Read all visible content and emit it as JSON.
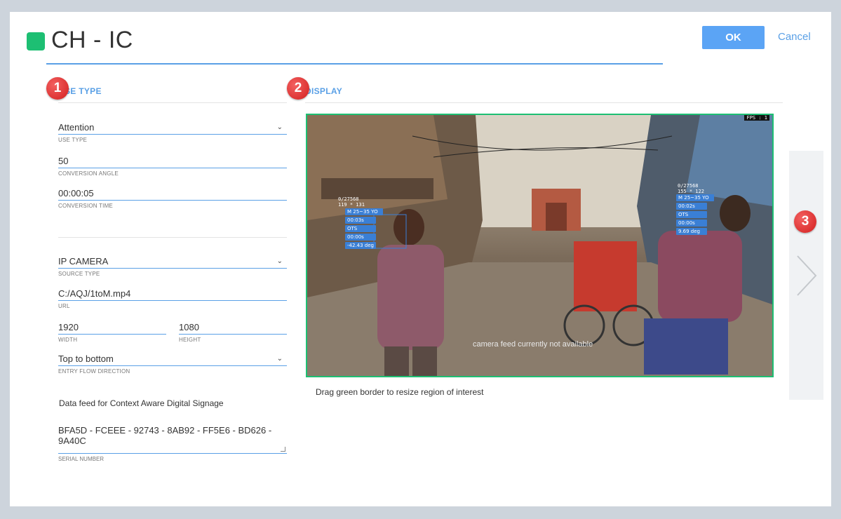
{
  "window": {
    "title": "CH - IC",
    "accent_color": "#1dbf73",
    "ok_label": "OK",
    "cancel_label": "Cancel"
  },
  "sections": {
    "use_type_heading": "USE TYPE",
    "display_heading": "DISPLAY"
  },
  "callouts": [
    "1",
    "2",
    "3"
  ],
  "use_fields": [
    {
      "value": "Attention",
      "label": "USE TYPE",
      "dropdown": true
    },
    {
      "value": "50",
      "label": "CONVERSION ANGLE"
    },
    {
      "value": "00:00:05",
      "label": "CONVERSION TIME"
    }
  ],
  "source_fields": {
    "source_type": {
      "value": "IP CAMERA",
      "label": "SOURCE TYPE"
    },
    "url": {
      "value": "C:/AQJ/1toM.mp4",
      "label": "URL"
    },
    "width": {
      "value": "1920",
      "label": "WIDTH"
    },
    "height": {
      "value": "1080",
      "label": "HEIGHT"
    },
    "entry_flow": {
      "value": "Top to bottom",
      "label": "ENTRY FLOW DIRECTION"
    }
  },
  "data_feed": {
    "heading": "Data feed for Context Aware Digital Signage",
    "serial": "BFA5D - FCEEE - 92743 - 8AB92 - FF5E6 - BD626 - 9A40C",
    "serial_label": "SERIAL NUMBER"
  },
  "display": {
    "feed_status": "camera feed currently not available",
    "hint": "Drag green border to resize region of interest",
    "fps_text": "FPS : 1",
    "left_overlay": {
      "id": "0/27568",
      "size": "119 * 131",
      "gender_age": "M 25~35 YO",
      "time": "00:03s",
      "ots": "OTS",
      "dwell": "00:00s",
      "angle": "-42.43 deg"
    },
    "right_overlay": {
      "id": "0/27568",
      "size": "155 * 122",
      "gender_age": "M 25~35 YO",
      "time": "00:02s",
      "ots": "OTS",
      "dwell": "00:00s",
      "angle": "9.69 deg"
    }
  }
}
